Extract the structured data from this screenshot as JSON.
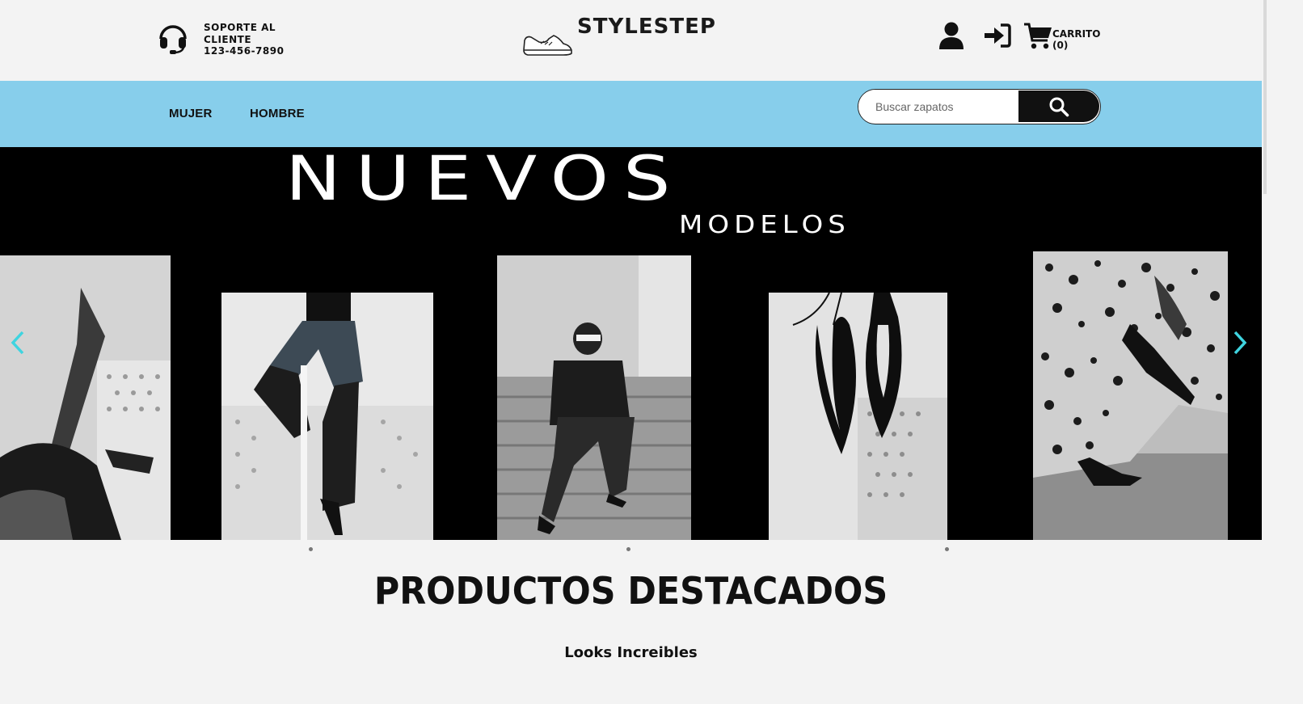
{
  "header": {
    "support_line1": "SOPORTE AL",
    "support_line2": "CLIENTE",
    "support_phone": "123-456-7890",
    "brand": "STYLESTEP",
    "cart_label": "CARRITO",
    "cart_count": "(0)",
    "icons": [
      "headset-icon",
      "sneaker-logo-icon",
      "user-icon",
      "login-icon",
      "cart-icon"
    ]
  },
  "nav": {
    "items": [
      {
        "label": "MUJER"
      },
      {
        "label": "HOMBRE"
      }
    ],
    "search_placeholder": "Buscar zapatos",
    "search_icon": "search-icon",
    "background_color": "#87ceeb"
  },
  "carousel": {
    "title": "NUEVOS",
    "subtitle": "MODELOS",
    "slide_count": 3,
    "accent_color": "#3fd4e0"
  },
  "main": {
    "section_title": "PRODUCTOS DESTACADOS",
    "section_subtitle": "Looks Increibles"
  }
}
